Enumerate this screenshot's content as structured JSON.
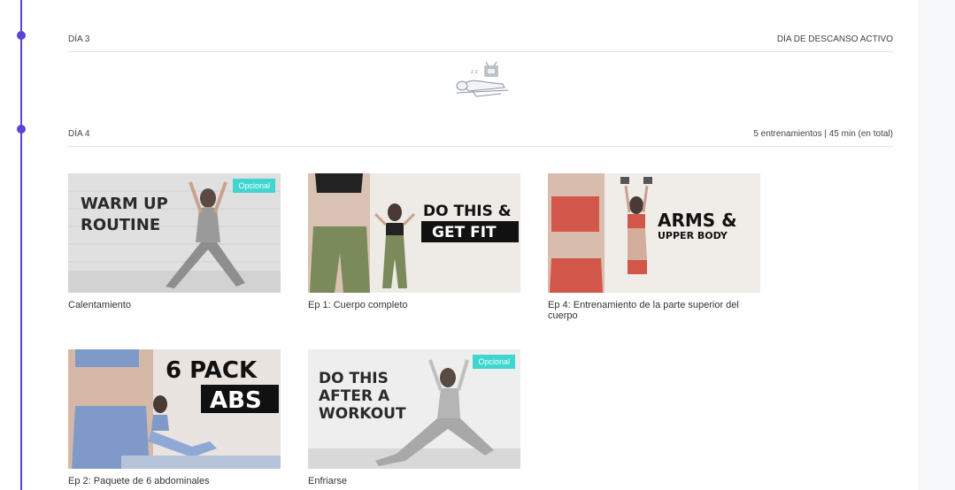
{
  "days": [
    {
      "label": "DÍA 3",
      "info": "DÍA DE DESCANSO ACTIVO",
      "icon": "rest-day-illustration"
    },
    {
      "label": "DÍA 4",
      "info": "5 entrenamientos | 45 min (en total)"
    }
  ],
  "workouts": [
    {
      "title": "Calentamiento",
      "badge": "Opcional",
      "thumb_line1": "WARM UP",
      "thumb_line2": "ROUTINE"
    },
    {
      "title": "Ep 1: Cuerpo completo",
      "thumb_line1": "DO THIS &",
      "thumb_line2": "GET FIT"
    },
    {
      "title": "Ep 4: Entrenamiento de la parte superior del cuerpo",
      "thumb_line1": "ARMS &",
      "thumb_line2": "UPPER BODY"
    },
    {
      "title": "Ep 2: Paquete de 6 abdominales",
      "thumb_line1": "6 PACK",
      "thumb_line2": "ABS"
    },
    {
      "title": "Enfriarse",
      "badge": "Opcional",
      "thumb_line1": "DO THIS",
      "thumb_line2": "AFTER A",
      "thumb_line3": "WORKOUT"
    }
  ],
  "colors": {
    "timeline": "#5b43d6",
    "badge": "#3ed6cf",
    "divider": "#e3e3e3",
    "panel": "#f7f8fa"
  }
}
